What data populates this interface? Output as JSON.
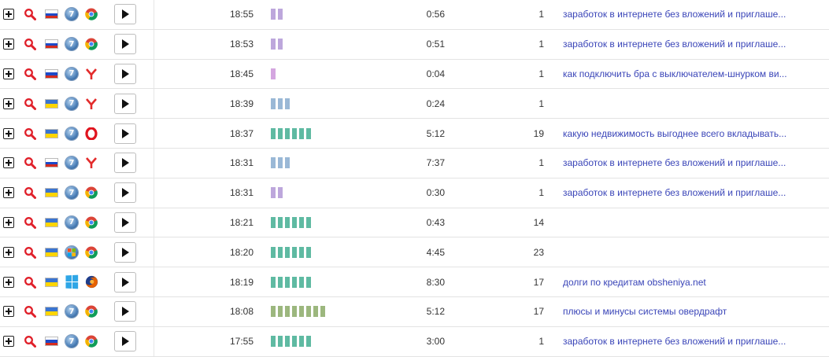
{
  "colors": {
    "link": "#3a45b8",
    "bars_short": "#bda7dc",
    "bars_blue": "#9ab8d6",
    "bars_green": "#5fbaa2",
    "bars_olive": "#9cb77e"
  },
  "rows": [
    {
      "flag": "ru",
      "os": "win7",
      "browser": "chrome-icon",
      "time": "18:55",
      "bars": 2,
      "bar_color": "#bda7dc",
      "duration": "0:56",
      "pages": "1",
      "query": "заработок в интернете без вложений и приглаше..."
    },
    {
      "flag": "ru",
      "os": "win7",
      "browser": "chrome-icon",
      "time": "18:53",
      "bars": 2,
      "bar_color": "#bda7dc",
      "duration": "0:51",
      "pages": "1",
      "query": "заработок в интернете без вложений и приглаше..."
    },
    {
      "flag": "ru",
      "os": "win7",
      "browser": "yandex-browser-icon",
      "time": "18:45",
      "bars": 1,
      "bar_color": "#d4a6e0",
      "duration": "0:04",
      "pages": "1",
      "query": "как подключить бра с выключателем-шнурком ви..."
    },
    {
      "flag": "ua",
      "os": "win7",
      "browser": "yandex-browser-icon",
      "time": "18:39",
      "bars": 3,
      "bar_color": "#9ab8d6",
      "duration": "0:24",
      "pages": "1",
      "query": ""
    },
    {
      "flag": "ua",
      "os": "win7",
      "browser": "opera-icon",
      "time": "18:37",
      "bars": 6,
      "bar_color": "#5fbaa2",
      "duration": "5:12",
      "pages": "19",
      "query": "какую недвижимость выгоднее всего вкладывать..."
    },
    {
      "flag": "ru",
      "os": "win7",
      "browser": "yandex-browser-icon",
      "time": "18:31",
      "bars": 3,
      "bar_color": "#9ab8d6",
      "duration": "7:37",
      "pages": "1",
      "query": "заработок в интернете без вложений и приглаше..."
    },
    {
      "flag": "ua",
      "os": "win7",
      "browser": "chrome-icon",
      "time": "18:31",
      "bars": 2,
      "bar_color": "#bda7dc",
      "duration": "0:30",
      "pages": "1",
      "query": "заработок в интернете без вложений и приглаше..."
    },
    {
      "flag": "ua",
      "os": "win7",
      "browser": "chrome-icon",
      "time": "18:21",
      "bars": 6,
      "bar_color": "#5fbaa2",
      "duration": "0:43",
      "pages": "14",
      "query": ""
    },
    {
      "flag": "ua",
      "os": "winxp",
      "browser": "chrome-icon",
      "time": "18:20",
      "bars": 6,
      "bar_color": "#5fbaa2",
      "duration": "4:45",
      "pages": "23",
      "query": ""
    },
    {
      "flag": "ua",
      "os": "win8",
      "browser": "firefox-icon",
      "time": "18:19",
      "bars": 6,
      "bar_color": "#5fbaa2",
      "duration": "8:30",
      "pages": "17",
      "query": "долги по кредитам obsheniya.net"
    },
    {
      "flag": "ua",
      "os": "win7",
      "browser": "chrome-icon",
      "time": "18:08",
      "bars": 8,
      "bar_color": "#9cb77e",
      "duration": "5:12",
      "pages": "17",
      "query": "плюсы и минусы системы овердрафт"
    },
    {
      "flag": "ru",
      "os": "win7",
      "browser": "chrome-icon",
      "time": "17:55",
      "bars": 6,
      "bar_color": "#5fbaa2",
      "duration": "3:00",
      "pages": "1",
      "query": "заработок в интернете без вложений и приглаше..."
    }
  ]
}
